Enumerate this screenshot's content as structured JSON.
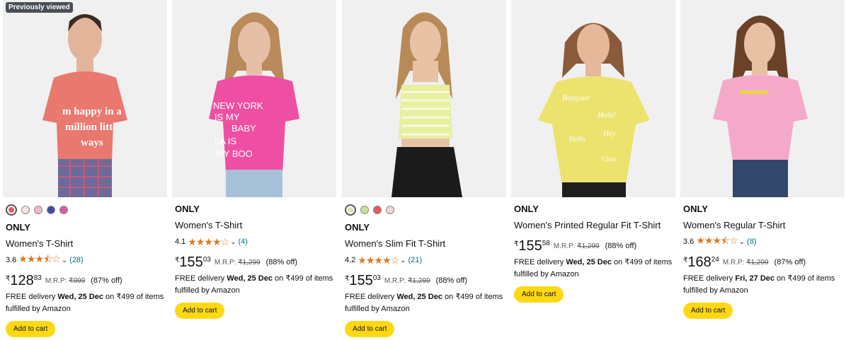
{
  "products": [
    {
      "badge": "Previously viewed",
      "shirt_color": "#e9786f",
      "swatches": [
        "#e35b63",
        "#f7e6e4",
        "#f5b8c6",
        "#3f4aa8",
        "#de5aa3"
      ],
      "selected_swatch": 0,
      "brand": "ONLY",
      "title": "Women's T-Shirt",
      "rating": "3.6",
      "stars": "★★★⯪☆",
      "reviews": "(28)",
      "currency": "₹",
      "price_whole": "128",
      "price_fraction": "83",
      "mrp_label": "M.R.P:",
      "mrp": "₹999",
      "discount": "(87% off)",
      "delivery_prefix": "FREE delivery ",
      "delivery_date": "Wed, 25 Dec",
      "delivery_suffix": " on ₹499 of items fulfilled by Amazon",
      "cart": "Add to cart"
    },
    {
      "badge": "",
      "shirt_color": "#ef4fa3",
      "swatches": [],
      "selected_swatch": -1,
      "brand": "ONLY",
      "title": "Women's T-Shirt",
      "rating": "4.1",
      "stars": "★★★★☆",
      "reviews": "(4)",
      "currency": "₹",
      "price_whole": "155",
      "price_fraction": "03",
      "mrp_label": "M.R.P:",
      "mrp": "₹1,299",
      "discount": "(88% off)",
      "delivery_prefix": "FREE delivery ",
      "delivery_date": "Wed, 25 Dec",
      "delivery_suffix": " on ₹499 of items fulfilled by Amazon",
      "cart": "Add to cart"
    },
    {
      "badge": "",
      "shirt_color": "#e8efa0",
      "swatches": [
        "#d6e6b4",
        "#c9df9b",
        "#e35b63",
        "#f3d6d6"
      ],
      "selected_swatch": 0,
      "brand": "ONLY",
      "title": "Women's Slim Fit T-Shirt",
      "rating": "4.2",
      "stars": "★★★★☆",
      "reviews": "(21)",
      "currency": "₹",
      "price_whole": "155",
      "price_fraction": "03",
      "mrp_label": "M.R.P:",
      "mrp": "₹1,299",
      "discount": "(88% off)",
      "delivery_prefix": "FREE delivery ",
      "delivery_date": "Wed, 25 Dec",
      "delivery_suffix": " on ₹499 of items fulfilled by Amazon",
      "cart": "Add to cart"
    },
    {
      "badge": "",
      "shirt_color": "#ece36e",
      "swatches": [],
      "selected_swatch": -1,
      "brand": "ONLY",
      "title": "Women's Printed Regular Fit T-Shirt",
      "rating": "",
      "stars": "",
      "reviews": "",
      "currency": "₹",
      "price_whole": "155",
      "price_fraction": "58",
      "mrp_label": "M.R.P:",
      "mrp": "₹1,299",
      "discount": "(88% off)",
      "delivery_prefix": "FREE delivery ",
      "delivery_date": "Wed, 25 Dec",
      "delivery_suffix": " on ₹499 of items fulfilled by Amazon",
      "cart": "Add to cart"
    },
    {
      "badge": "",
      "shirt_color": "#f5a9c9",
      "swatches": [],
      "selected_swatch": -1,
      "brand": "ONLY",
      "title": "Women's Regular T-Shirt",
      "rating": "3.6",
      "stars": "★★★⯪☆",
      "reviews": "(8)",
      "currency": "₹",
      "price_whole": "168",
      "price_fraction": "24",
      "mrp_label": "M.R.P:",
      "mrp": "₹1,299",
      "discount": "(87% off)",
      "delivery_prefix": "FREE delivery ",
      "delivery_date": "Fri, 27 Dec",
      "delivery_suffix": " on ₹499 of items fulfilled by Amazon",
      "cart": "Add to cart"
    }
  ],
  "shirt_prints": [
    [
      "m happy in a",
      "million littl",
      "ways"
    ],
    [
      "NEW YORK",
      "IS MY",
      "BABY",
      "LA  IS",
      "MY  BOO"
    ],
    [],
    [
      "Bonjour",
      "Hola!",
      "Hey",
      "Hello",
      "Ciao"
    ],
    []
  ]
}
